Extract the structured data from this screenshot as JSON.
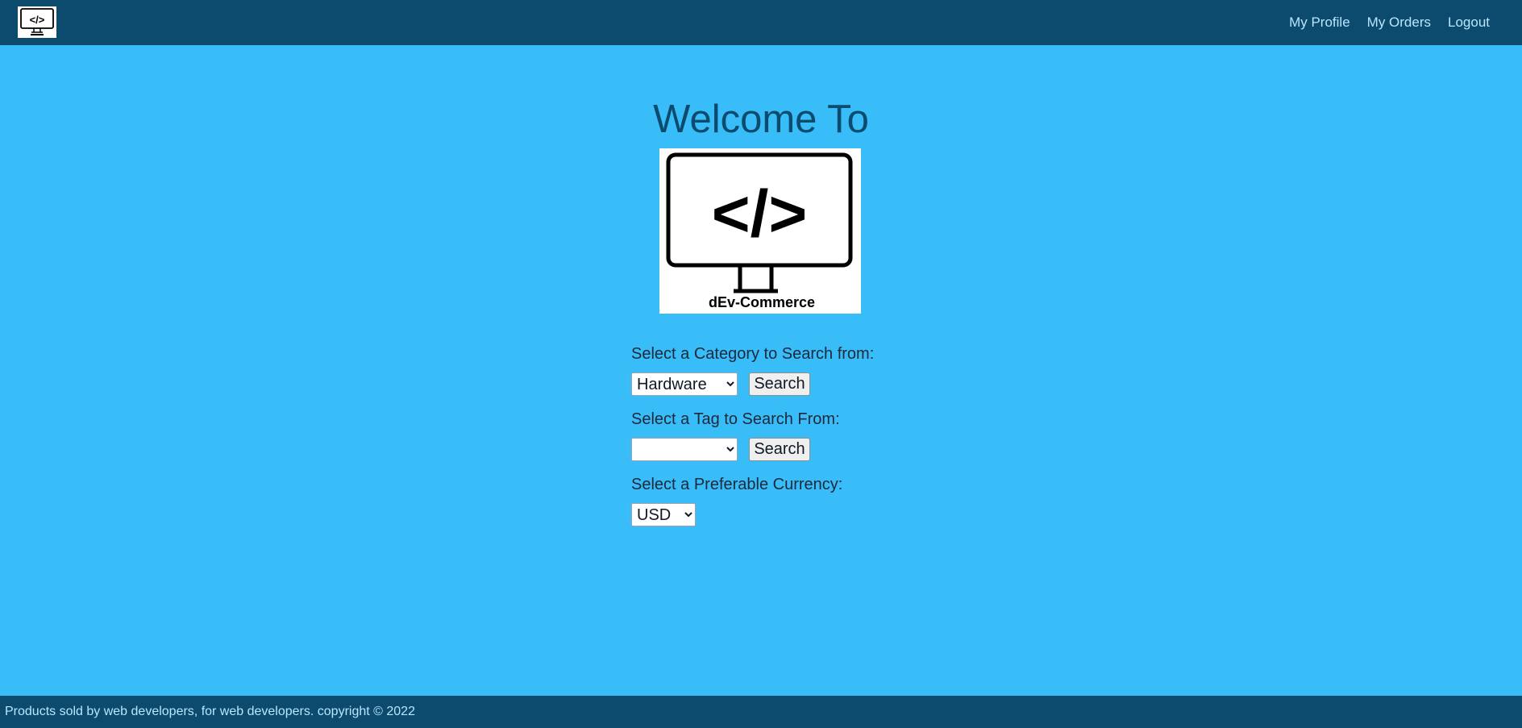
{
  "header": {
    "logo_icon": "dev-commerce-monitor-logo",
    "nav": [
      {
        "label": "My Profile"
      },
      {
        "label": "My Orders"
      },
      {
        "label": "Logout"
      }
    ]
  },
  "main": {
    "welcome_title": "Welcome To",
    "logo_text": "dEv-Commerce",
    "logo_code": "</>",
    "category": {
      "label": "Select a Category to Search from:",
      "selected": "Hardware",
      "button": "Search"
    },
    "tag": {
      "label": "Select a Tag to Search From:",
      "selected": "",
      "button": "Search"
    },
    "currency": {
      "label": "Select a Preferable Currency:",
      "selected": "USD"
    }
  },
  "footer": {
    "text": "Products sold by web developers, for web developers. copyright © 2022"
  },
  "colors": {
    "page_background": "#38bdf8",
    "bar_background": "#0c4a6e",
    "nav_link": "#bae6fd",
    "title": "#0c4a6e"
  }
}
